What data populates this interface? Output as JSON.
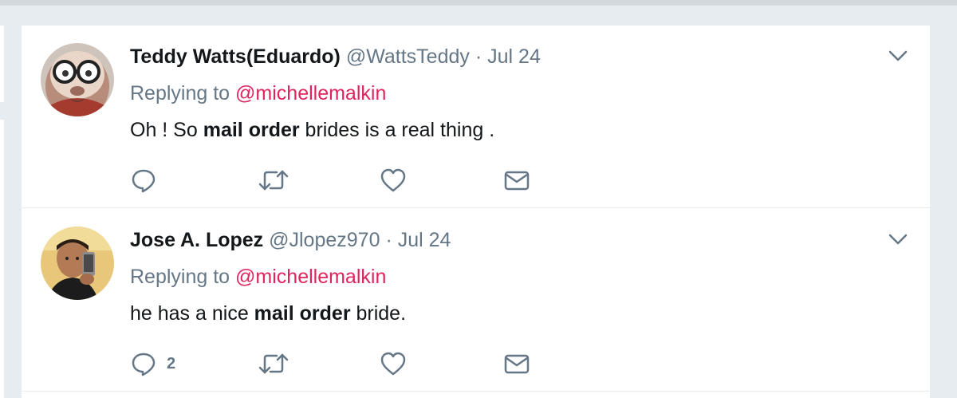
{
  "tweets": [
    {
      "name": "Teddy Watts(Eduardo)",
      "handle": "@WattsTeddy",
      "separator": "·",
      "date": "Jul 24",
      "replying_prefix": "Replying to",
      "replying_to": "@michellemalkin",
      "text_parts": [
        "Oh ! So ",
        "mail order",
        " brides is a real thing ."
      ],
      "reply_count": "",
      "avatar_icon": "monkey-glasses-avatar"
    },
    {
      "name": "Jose A. Lopez",
      "handle": "@Jlopez970",
      "separator": "·",
      "date": "Jul 24",
      "replying_prefix": "Replying to",
      "replying_to": "@michellemalkin",
      "text_parts": [
        "he has a nice ",
        "mail order",
        " bride."
      ],
      "reply_count": "2",
      "avatar_icon": "man-selfie-avatar"
    }
  ],
  "icons": {
    "reply": "reply-icon",
    "retweet": "retweet-icon",
    "like": "heart-icon",
    "dm": "envelope-icon",
    "menu": "chevron-down-icon"
  },
  "colors": {
    "mention": "#e0245e",
    "secondary": "#657786",
    "primary_text": "#14171a",
    "background": "#e6ecf0"
  }
}
